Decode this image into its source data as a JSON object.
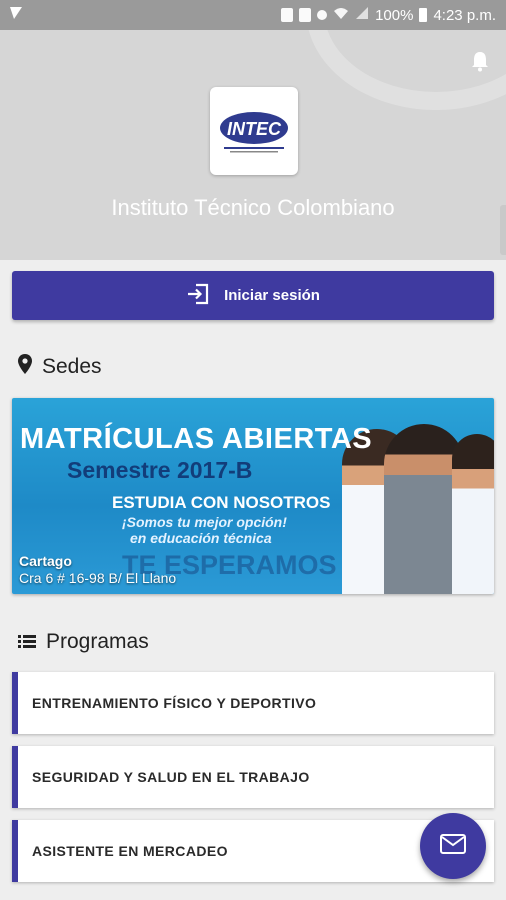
{
  "status_bar": {
    "battery": "100%",
    "time": "4:23 p.m."
  },
  "header": {
    "institution_name": "Instituto Técnico Colombiano",
    "logo_text": "INTEC"
  },
  "login": {
    "label": "Iniciar sesión"
  },
  "sedes": {
    "title": "Sedes",
    "items": [
      {
        "banner_line1": "MATRÍCULAS ABIERTAS",
        "banner_line2": "Semestre 2017-B",
        "banner_line3": "ESTUDIA CON NOSOTROS",
        "banner_line4": "¡Somos tu mejor opción!",
        "banner_line5": "en educación técnica",
        "banner_line6": "TE ESPERAMOS",
        "city": "Cartago",
        "address": "Cra 6 # 16-98 B/ El Llano"
      }
    ]
  },
  "programas": {
    "title": "Programas",
    "items": [
      {
        "label": "ENTRENAMIENTO FÍSICO Y DEPORTIVO"
      },
      {
        "label": "SEGURIDAD Y SALUD EN EL TRABAJO"
      },
      {
        "label": "ASISTENTE EN MERCADEO"
      }
    ]
  },
  "colors": {
    "primary": "#3f3aa0",
    "header_bg": "#d6d6d6",
    "page_bg": "#eeeeee"
  }
}
